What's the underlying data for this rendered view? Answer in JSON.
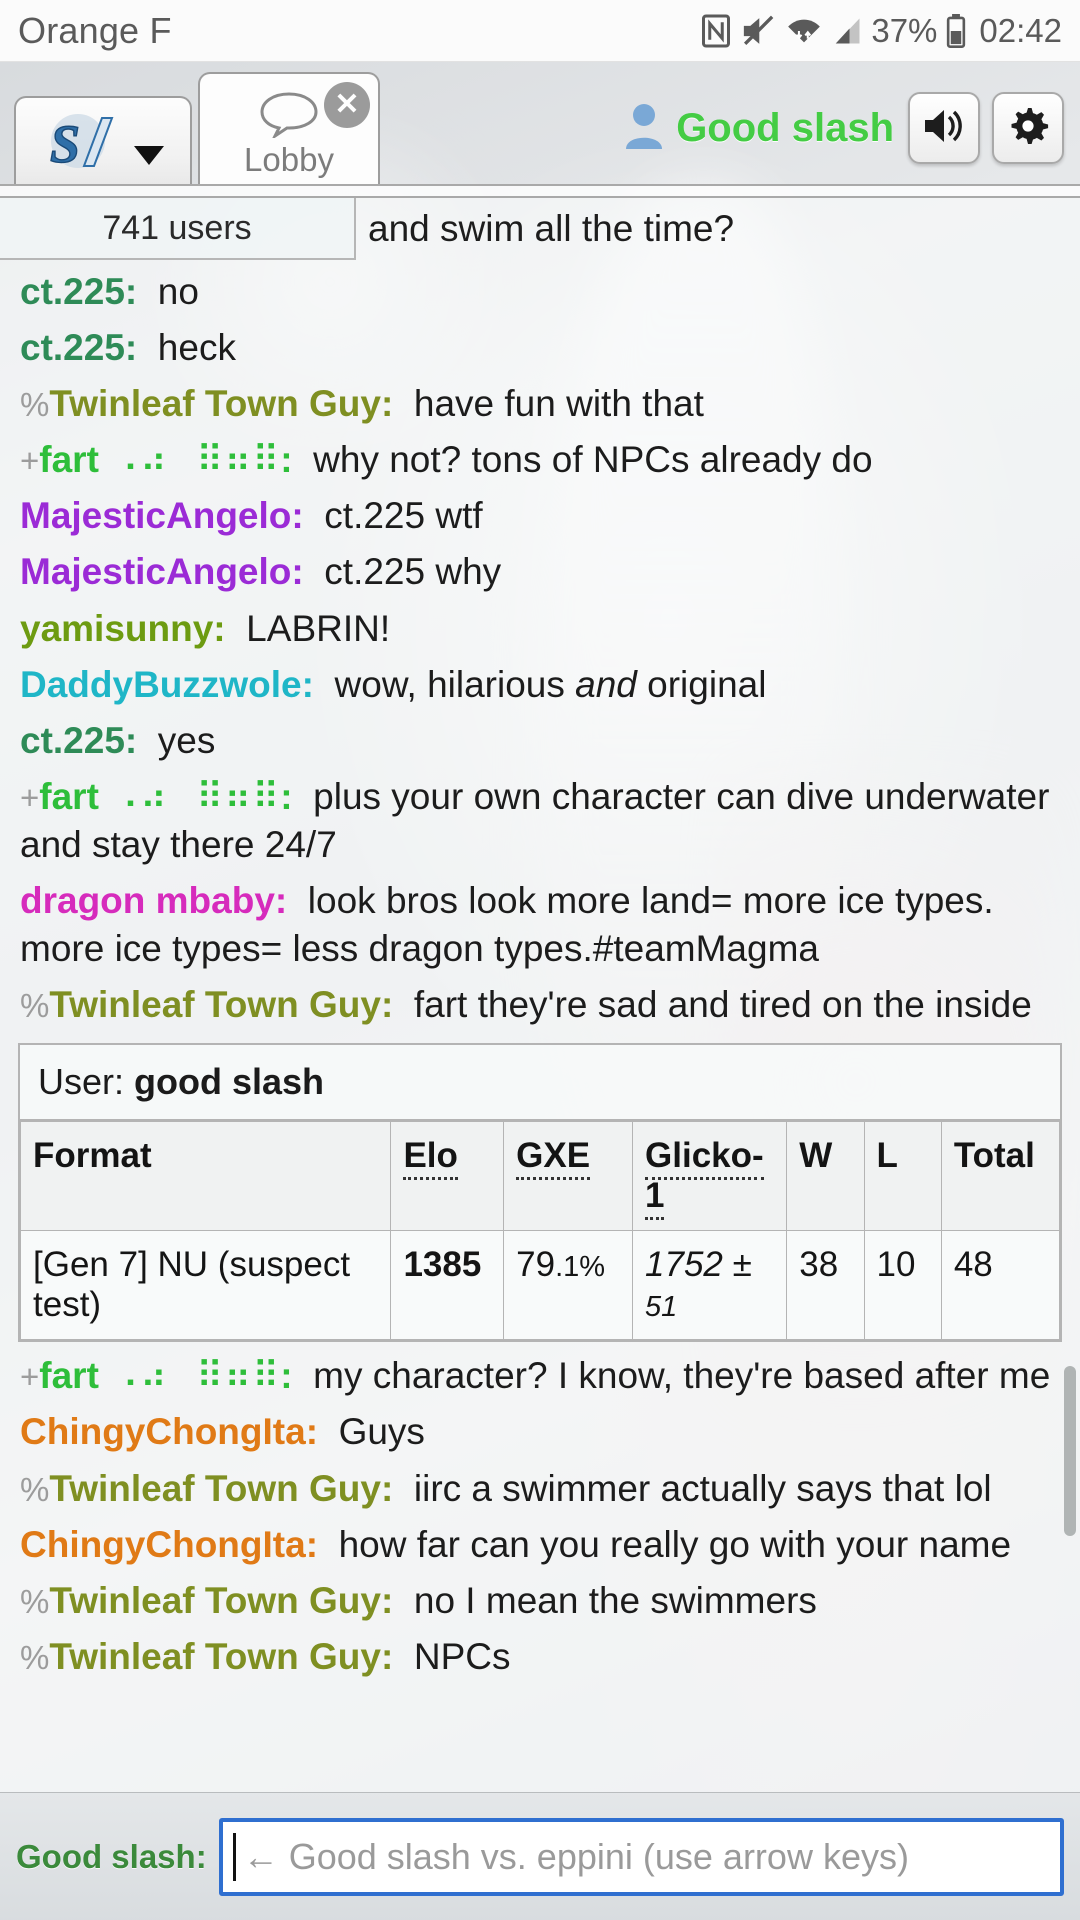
{
  "status_bar": {
    "carrier": "Orange F",
    "battery_percent": "37%",
    "clock": "02:42",
    "icons": [
      "nfc-icon",
      "mute-icon",
      "wifi-icon",
      "signal-icon",
      "battery-icon"
    ]
  },
  "tabs": {
    "home_tab_name": "home-tab",
    "lobby_label": "Lobby",
    "close_glyph": "✕"
  },
  "account": {
    "username": "Good slash",
    "sound_icon": "speaker-icon",
    "settings_icon": "gear-icon"
  },
  "room": {
    "user_count_label": "741 users",
    "overflow_line": "and swim all the time?"
  },
  "colors": {
    "username_green": "#44cc44",
    "ct225": "#2e8b57",
    "twinleaf": "#7f8f22",
    "fart": "#2ebe3a",
    "majestic_angelo": "#9b2bd6",
    "yamisunny": "#6d9b11",
    "daddybuzzwole": "#1fb6c7",
    "dragon_mbaby": "#d62bbc",
    "chingychonglta": "#e07a16",
    "input_border": "#2f6fd0"
  },
  "messages": [
    {
      "rank": "",
      "user": "ct.225",
      "color_key": "ct225",
      "braille": "",
      "body": "no"
    },
    {
      "rank": "",
      "user": "ct.225",
      "color_key": "ct225",
      "braille": "",
      "body": "heck"
    },
    {
      "rank": "%",
      "user": "Twinleaf Town Guy",
      "color_key": "twinleaf",
      "braille": "",
      "body": "have fun with that"
    },
    {
      "rank": "+",
      "user": "fart",
      "color_key": "fart",
      "braille": "⠠⠴⠀⠿⠶⠿",
      "body": "why not? tons of NPCs already do"
    },
    {
      "rank": "",
      "user": "MajesticAngelo",
      "color_key": "majestic_angelo",
      "braille": "",
      "body": "ct.225 wtf"
    },
    {
      "rank": "",
      "user": "MajesticAngelo",
      "color_key": "majestic_angelo",
      "braille": "",
      "body": "ct.225 why"
    },
    {
      "rank": "",
      "user": "yamisunny",
      "color_key": "yamisunny",
      "braille": "",
      "body": "LABRIN!"
    },
    {
      "rank": "",
      "user": "DaddyBuzzwole",
      "color_key": "daddybuzzwole",
      "braille": "",
      "body_html": "wow, hilarious <em>and</em> original"
    },
    {
      "rank": "",
      "user": "ct.225",
      "color_key": "ct225",
      "braille": "",
      "body": "yes"
    },
    {
      "rank": "+",
      "user": "fart",
      "color_key": "fart",
      "braille": "⠠⠴⠀⠿⠶⠿",
      "body": "plus your own character can dive underwater and stay there 24/7"
    },
    {
      "rank": "",
      "user": "dragon mbaby",
      "color_key": "dragon_mbaby",
      "braille": "",
      "body": "look bros look more land= more ice types. more ice types= less dragon types.#teamMagma"
    },
    {
      "rank": "%",
      "user": "Twinleaf Town Guy",
      "color_key": "twinleaf",
      "braille": "",
      "body": "fart they're sad and tired on the inside"
    }
  ],
  "messages_after_table": [
    {
      "rank": "+",
      "user": "fart",
      "color_key": "fart",
      "braille": "⠠⠴⠀⠿⠶⠿",
      "body": "my character? I know, they're based after me"
    },
    {
      "rank": "",
      "user": "ChingyChongIta",
      "color_key": "chingychonglta",
      "braille": "",
      "body": "Guys"
    },
    {
      "rank": "%",
      "user": "Twinleaf Town Guy",
      "color_key": "twinleaf",
      "braille": "",
      "body": "iirc a swimmer actually says that lol"
    },
    {
      "rank": "",
      "user": "ChingyChongIta",
      "color_key": "chingychonglta",
      "braille": "",
      "body": "how far can you really go with your name"
    },
    {
      "rank": "%",
      "user": "Twinleaf Town Guy",
      "color_key": "twinleaf",
      "braille": "",
      "body": "no I mean the swimmers"
    },
    {
      "rank": "%",
      "user": "Twinleaf Town Guy",
      "color_key": "twinleaf",
      "braille": "",
      "body": "NPCs"
    }
  ],
  "rating_table": {
    "user_prefix": "User:",
    "user_name": "good slash",
    "headers": [
      "Format",
      "Elo",
      "GXE",
      "Glicko-1",
      "W",
      "L",
      "Total"
    ],
    "header_abbrs": [
      false,
      true,
      true,
      true,
      false,
      false,
      false
    ],
    "rows": [
      {
        "format": "[Gen 7] NU (suspect test)",
        "elo": "1385",
        "gxe_whole": "79",
        "gxe_frac": ".1%",
        "glicko": "1752 ±",
        "glicko_dev": "51",
        "w": "38",
        "l": "10",
        "total": "48"
      }
    ]
  },
  "input": {
    "username_prompt": "Good slash:",
    "placeholder": "← Good slash vs. eppini (use arrow keys)"
  }
}
